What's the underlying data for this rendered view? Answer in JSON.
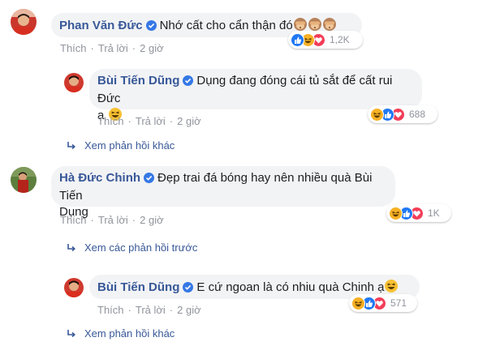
{
  "colors": {
    "name_blue": "#385898",
    "bubble_bg": "#f2f3f5",
    "meta_gray": "#90949c",
    "like_blue": "#2078f4",
    "love_red": "#f33e58",
    "haha_yellow": "#f7b125",
    "verified_blue": "#3578e5"
  },
  "comments": [
    {
      "author": "Phan Văn Đức",
      "text": "Nhớ cất cho cẩn thận đó",
      "emojis": [
        "see-no-evil-monkey",
        "see-no-evil-monkey",
        "see-no-evil-monkey"
      ],
      "actions": {
        "like": "Thích",
        "reply": "Trả lời",
        "time": "2 giờ"
      },
      "reactions": {
        "icons": [
          "like",
          "haha",
          "love"
        ],
        "count": "1,2K"
      },
      "replies": [
        {
          "author": "Bùi Tiến Dũng",
          "text_line1": "Dụng đang đóng cái tủ sắt để cất rui Đức",
          "text_line2": "ạ",
          "emojis": [
            "grinning-squint-face"
          ],
          "actions": {
            "like": "Thích",
            "reply": "Trả lời",
            "time": "2 giờ"
          },
          "reactions": {
            "icons": [
              "haha",
              "like",
              "love"
            ],
            "count": "688"
          }
        }
      ],
      "more_replies": "Xem phản hồi khác"
    },
    {
      "author": "Hà Đức Chinh",
      "text_line1": "Đẹp trai đá bóng hay nên nhiều quà Bùi Tiến",
      "text_line2": "Dụng",
      "actions": {
        "like": "Thích",
        "reply": "Trả lời",
        "time": "2 giờ"
      },
      "reactions": {
        "icons": [
          "haha",
          "like",
          "love"
        ],
        "count": "1K"
      },
      "previous_replies": "Xem các phản hồi trước",
      "replies": [
        {
          "author": "Bùi Tiến Dũng",
          "text": "E cứ ngoan là có nhiu quà Chinh ạ",
          "emojis": [
            "grinning-squint-face"
          ],
          "actions": {
            "like": "Thích",
            "reply": "Trả lời",
            "time": "2 giờ"
          },
          "reactions": {
            "icons": [
              "haha",
              "like",
              "love"
            ],
            "count": "571"
          }
        }
      ],
      "more_replies": "Xem phản hồi khác"
    }
  ]
}
